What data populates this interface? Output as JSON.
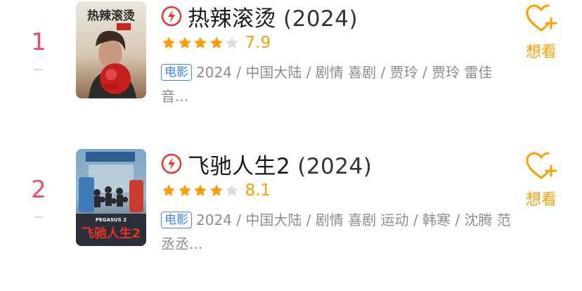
{
  "movies": [
    {
      "rank": "1",
      "title": "热辣滚烫",
      "year": "(2024)",
      "stars_filled": 4,
      "stars_total": 5,
      "score": "7.9",
      "type_badge": "电影",
      "meta": "2024 / 中国大陆 / 剧情 喜剧 / 贾玲 / 贾玲 雷佳音...",
      "want_label": "想看",
      "poster_title": "热辣滚烫"
    },
    {
      "rank": "2",
      "title": "飞驰人生2",
      "year": "(2024)",
      "stars_filled": 4,
      "stars_total": 5,
      "score": "8.1",
      "type_badge": "电影",
      "meta": "2024 / 中国大陆 / 剧情 喜剧 运动 / 韩寒 / 沈腾 范丞丞...",
      "want_label": "想看",
      "poster_title": "飞驰人生2",
      "poster_subtitle": "PEGASUS 2"
    }
  ],
  "colors": {
    "rank": "#ec4b6a",
    "accent": "#ff9c00",
    "badge": "#3a86ff",
    "play_icon": "#e8352b",
    "star_empty": "#dcdcdc"
  },
  "icons": {
    "play": "play-circle-icon",
    "star": "star-icon",
    "want": "heart-plus-icon"
  }
}
